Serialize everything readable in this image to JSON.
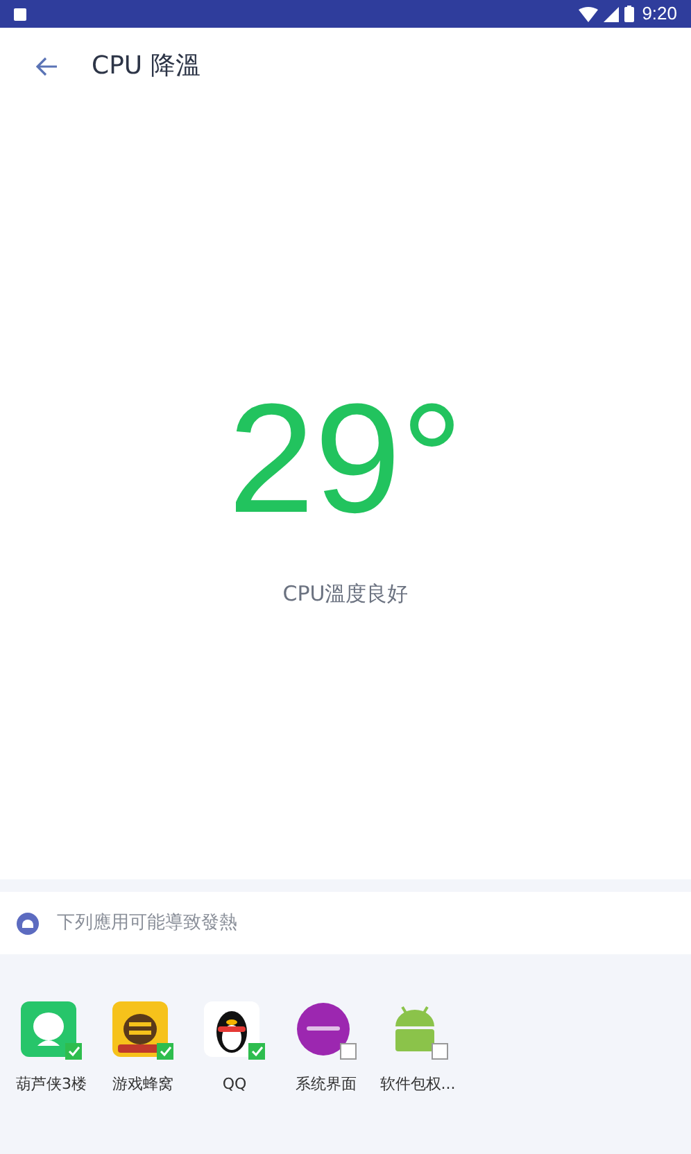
{
  "status_bar": {
    "time": "9:20"
  },
  "header": {
    "title": "CPU 降溫"
  },
  "temperature": {
    "value": "29°",
    "status": "CPU溫度良好"
  },
  "section": {
    "title": "下列應用可能導致發熱"
  },
  "apps": [
    {
      "name": "葫芦侠3楼",
      "checked": true
    },
    {
      "name": "游戏蜂窝",
      "checked": true
    },
    {
      "name": "QQ",
      "checked": true
    },
    {
      "name": "系统界面",
      "checked": false
    },
    {
      "name": "软件包权...",
      "checked": false
    }
  ]
}
